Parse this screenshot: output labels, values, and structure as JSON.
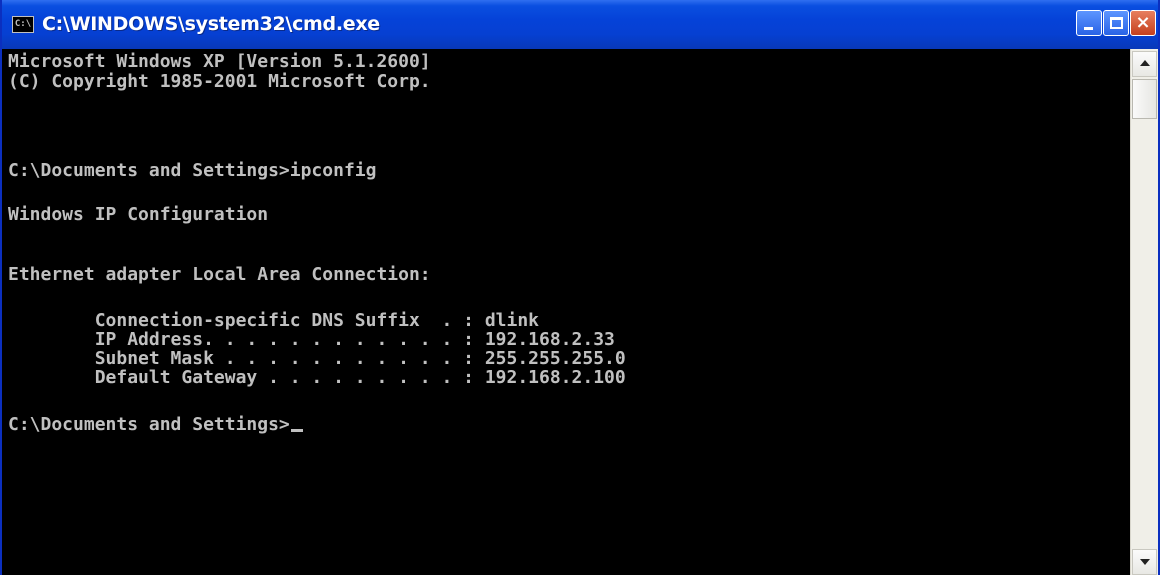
{
  "window": {
    "title": "C:\\WINDOWS\\system32\\cmd.exe",
    "icon": "cmd-icon",
    "icon_glyph": "C:\\",
    "buttons": {
      "minimize": "minimize-icon",
      "maximize": "maximize-icon",
      "close": "close-icon",
      "close_glyph": "×"
    },
    "colors": {
      "titlebar": "#0542d8",
      "console_bg": "#000000",
      "console_text": "#c0c0c0"
    }
  },
  "console": {
    "lines": [
      "Microsoft Windows XP [Version 5.1.2600]",
      "(C) Copyright 1985-2001 Microsoft Corp.",
      "",
      "C:\\Documents and Settings>ipconfig",
      "",
      "Windows IP Configuration",
      "",
      "",
      "Ethernet adapter Local Area Connection:",
      "",
      "        Connection-specific DNS Suffix  . : dlink",
      "        IP Address. . . . . . . . . . . . : 192.168.2.33",
      "        Subnet Mask . . . . . . . . . . . : 255.255.255.0",
      "        Default Gateway . . . . . . . . . : 192.168.2.100",
      "",
      "C:\\Documents and Settings>"
    ]
  },
  "scrollbar": {
    "up": "scroll-up-arrow-icon",
    "down": "scroll-down-arrow-icon"
  }
}
